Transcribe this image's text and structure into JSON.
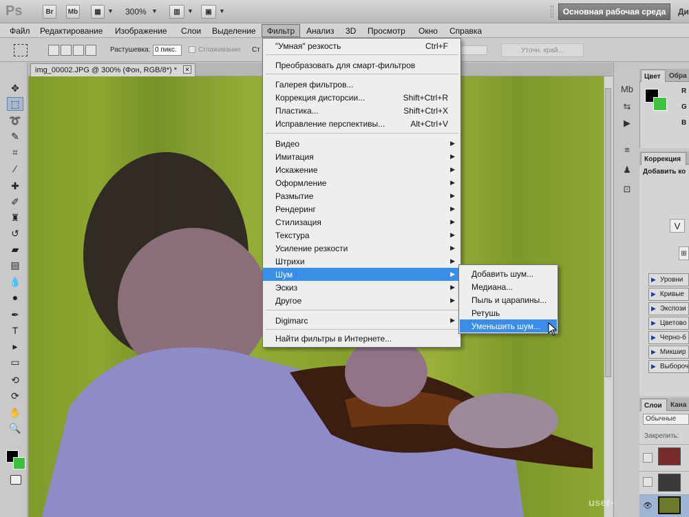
{
  "titlebar": {
    "logo": "Ps",
    "btn_br": "Br",
    "btn_mb": "Mb",
    "zoom": "300%",
    "workspace": "Основная рабочая среда",
    "workspace_extra": "Ди"
  },
  "menubar": [
    "Файл",
    "Редактирование",
    "Изображение",
    "Слои",
    "Выделение",
    "Фильтр",
    "Анализ",
    "3D",
    "Просмотр",
    "Окно",
    "Справка"
  ],
  "options": {
    "feather_label": "Растушевка:",
    "feather_value": "0 пикс.",
    "antialias": "Сглаживание",
    "style_label": "Ст",
    "refine_edge": "Уточн. край..."
  },
  "document": {
    "tab_title": "img_00002.JPG @ 300% (Фон, RGB/8*) *",
    "close": "✕"
  },
  "filter_menu": {
    "items": [
      {
        "label": "\"Умная\" резкость",
        "shortcut": "Ctrl+F"
      },
      {
        "label": "Преобразовать для смарт-фильтров",
        "shortcut": ""
      },
      {
        "label": "Галерея фильтров...",
        "shortcut": ""
      },
      {
        "label": "Коррекция дисторсии...",
        "shortcut": "Shift+Ctrl+R"
      },
      {
        "label": "Пластика...",
        "shortcut": "Shift+Ctrl+X"
      },
      {
        "label": "Исправление перспективы...",
        "shortcut": "Alt+Ctrl+V"
      },
      {
        "label": "Видео",
        "shortcut": ""
      },
      {
        "label": "Имитация",
        "shortcut": ""
      },
      {
        "label": "Искажение",
        "shortcut": ""
      },
      {
        "label": "Оформление",
        "shortcut": ""
      },
      {
        "label": "Размытие",
        "shortcut": ""
      },
      {
        "label": "Рендеринг",
        "shortcut": ""
      },
      {
        "label": "Стилизация",
        "shortcut": ""
      },
      {
        "label": "Текстура",
        "shortcut": ""
      },
      {
        "label": "Усиление резкости",
        "shortcut": ""
      },
      {
        "label": "Штрихи",
        "shortcut": ""
      },
      {
        "label": "Шум",
        "shortcut": ""
      },
      {
        "label": "Эскиз",
        "shortcut": ""
      },
      {
        "label": "Другое",
        "shortcut": ""
      },
      {
        "label": "Digimarc",
        "shortcut": ""
      },
      {
        "label": "Найти фильтры в Интернете...",
        "shortcut": ""
      }
    ]
  },
  "noise_menu": {
    "items": [
      "Добавить шум...",
      "Медиана...",
      "Пыль и царапины...",
      "Ретушь",
      "Уменьшить шум..."
    ]
  },
  "panels": {
    "color_tab": "Цвет",
    "color_tab2": "Обра",
    "r": "R",
    "g": "G",
    "b": "B",
    "adjust_tab": "Коррекция",
    "adjust_subtitle": "Добавить ко",
    "adjust_items": [
      "Уровни",
      "Кривые",
      "Экспози",
      "Цветово",
      "Черно-б",
      "Микшир",
      "Выбороч"
    ],
    "layers_tab": "Слои",
    "layers_tab2": "Кана",
    "blend_mode": "Обычные",
    "lock_label": "Закрепить:"
  },
  "watermark": "user-life.com",
  "colors": {
    "highlight": "#3b8ee8",
    "foreground": "#000000",
    "background": "#3cc23c"
  }
}
